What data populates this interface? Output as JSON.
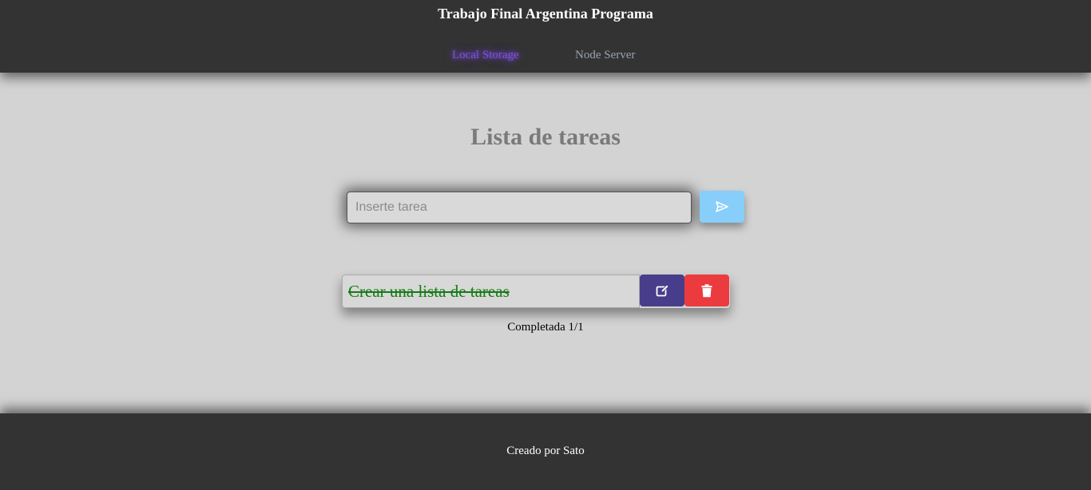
{
  "header": {
    "title": "Trabajo Final Argentina Programa",
    "nav": [
      {
        "label": "Local Storage",
        "active": true
      },
      {
        "label": "Node Server",
        "active": false
      }
    ]
  },
  "main": {
    "title": "Lista de tareas",
    "input": {
      "placeholder": "Inserte tarea",
      "value": ""
    },
    "send_icon": "send-icon",
    "tasks": [
      {
        "text": "Crear una lista de tareas",
        "completed": true
      }
    ],
    "status": "Completada 1/1"
  },
  "footer": {
    "text": "Creado por Sato"
  },
  "colors": {
    "header_bg": "#333333",
    "page_bg": "#d3d3d3",
    "nav_active": "#7b4fd9",
    "send_button": "#87cefa",
    "edit_button": "#483d8b",
    "delete_button": "#ec3b3f",
    "completed_text": "#157a15"
  }
}
